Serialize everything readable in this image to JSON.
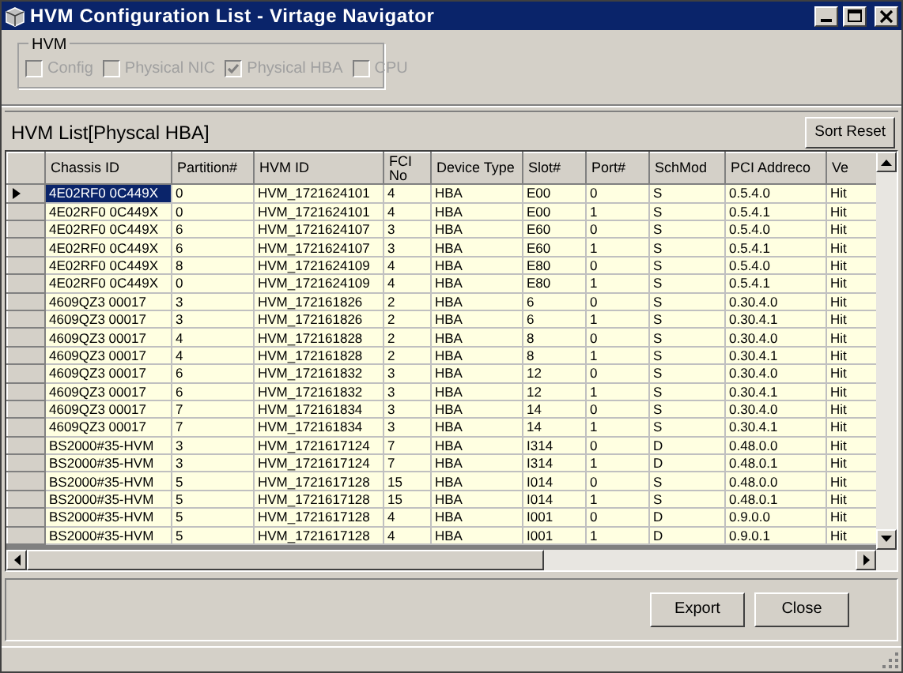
{
  "window": {
    "title": "HVM Configuration List - Virtage Navigator"
  },
  "filter_group": {
    "title": "HVM",
    "options": [
      {
        "label": "Config",
        "checked": false,
        "disabled": true
      },
      {
        "label": "Physical NIC",
        "checked": false,
        "disabled": true
      },
      {
        "label": "Physical HBA",
        "checked": true,
        "disabled": true
      },
      {
        "label": "CPU",
        "checked": false,
        "disabled": true
      }
    ]
  },
  "list_panel": {
    "title": "HVM List[Physcal HBA]",
    "sort_button": "Sort Reset"
  },
  "table": {
    "columns": [
      "Chassis ID",
      "Partition#",
      "HVM ID",
      "FCI No",
      "Device Type",
      "Slot#",
      "Port#",
      "SchMod",
      "PCI Addreco",
      "Ve"
    ],
    "rows": [
      {
        "selected": true,
        "cells": [
          "4E02RF0 0C449X",
          "0",
          "HVM_1721624101",
          "4",
          "HBA",
          "E00",
          "0",
          "S",
          "0.5.4.0",
          "Hit"
        ]
      },
      {
        "selected": false,
        "cells": [
          "4E02RF0 0C449X",
          "0",
          "HVM_1721624101",
          "4",
          "HBA",
          "E00",
          "1",
          "S",
          "0.5.4.1",
          "Hit"
        ]
      },
      {
        "selected": false,
        "cells": [
          "4E02RF0 0C449X",
          "6",
          "HVM_1721624107",
          "3",
          "HBA",
          "E60",
          "0",
          "S",
          "0.5.4.0",
          "Hit"
        ]
      },
      {
        "selected": false,
        "cells": [
          "4E02RF0 0C449X",
          "6",
          "HVM_1721624107",
          "3",
          "HBA",
          "E60",
          "1",
          "S",
          "0.5.4.1",
          "Hit"
        ]
      },
      {
        "selected": false,
        "cells": [
          "4E02RF0 0C449X",
          "8",
          "HVM_1721624109",
          "4",
          "HBA",
          "E80",
          "0",
          "S",
          "0.5.4.0",
          "Hit"
        ]
      },
      {
        "selected": false,
        "cells": [
          "4E02RF0 0C449X",
          "0",
          "HVM_1721624109",
          "4",
          "HBA",
          "E80",
          "1",
          "S",
          "0.5.4.1",
          "Hit"
        ]
      },
      {
        "selected": false,
        "cells": [
          "4609QZ3 00017",
          "3",
          "HVM_172161826",
          "2",
          "HBA",
          "6",
          "0",
          "S",
          "0.30.4.0",
          "Hit"
        ]
      },
      {
        "selected": false,
        "cells": [
          "4609QZ3 00017",
          "3",
          "HVM_172161826",
          "2",
          "HBA",
          "6",
          "1",
          "S",
          "0.30.4.1",
          "Hit"
        ]
      },
      {
        "selected": false,
        "cells": [
          "4609QZ3 00017",
          "4",
          "HVM_172161828",
          "2",
          "HBA",
          "8",
          "0",
          "S",
          "0.30.4.0",
          "Hit"
        ]
      },
      {
        "selected": false,
        "cells": [
          "4609QZ3 00017",
          "4",
          "HVM_172161828",
          "2",
          "HBA",
          "8",
          "1",
          "S",
          "0.30.4.1",
          "Hit"
        ]
      },
      {
        "selected": false,
        "cells": [
          "4609QZ3 00017",
          "6",
          "HVM_172161832",
          "3",
          "HBA",
          "12",
          "0",
          "S",
          "0.30.4.0",
          "Hit"
        ]
      },
      {
        "selected": false,
        "cells": [
          "4609QZ3 00017",
          "6",
          "HVM_172161832",
          "3",
          "HBA",
          "12",
          "1",
          "S",
          "0.30.4.1",
          "Hit"
        ]
      },
      {
        "selected": false,
        "cells": [
          "4609QZ3 00017",
          "7",
          "HVM_172161834",
          "3",
          "HBA",
          "14",
          "0",
          "S",
          "0.30.4.0",
          "Hit"
        ]
      },
      {
        "selected": false,
        "cells": [
          "4609QZ3 00017",
          "7",
          "HVM_172161834",
          "3",
          "HBA",
          "14",
          "1",
          "S",
          "0.30.4.1",
          "Hit"
        ]
      },
      {
        "selected": false,
        "cells": [
          "BS2000#35-HVM",
          "3",
          "HVM_1721617124",
          "7",
          "HBA",
          "I314",
          "0",
          "D",
          "0.48.0.0",
          "Hit"
        ]
      },
      {
        "selected": false,
        "cells": [
          "BS2000#35-HVM",
          "3",
          "HVM_1721617124",
          "7",
          "HBA",
          "I314",
          "1",
          "D",
          "0.48.0.1",
          "Hit"
        ]
      },
      {
        "selected": false,
        "cells": [
          "BS2000#35-HVM",
          "5",
          "HVM_1721617128",
          "15",
          "HBA",
          "I014",
          "0",
          "S",
          "0.48.0.0",
          "Hit"
        ]
      },
      {
        "selected": false,
        "cells": [
          "BS2000#35-HVM",
          "5",
          "HVM_1721617128",
          "15",
          "HBA",
          "I014",
          "1",
          "S",
          "0.48.0.1",
          "Hit"
        ]
      },
      {
        "selected": false,
        "cells": [
          "BS2000#35-HVM",
          "5",
          "HVM_1721617128",
          "4",
          "HBA",
          "I001",
          "0",
          "D",
          "0.9.0.0",
          "Hit"
        ]
      },
      {
        "selected": false,
        "cells": [
          "BS2000#35-HVM",
          "5",
          "HVM_1721617128",
          "4",
          "HBA",
          "I001",
          "1",
          "D",
          "0.9.0.1",
          "Hit"
        ]
      }
    ]
  },
  "buttons": [
    "Export",
    "Close"
  ]
}
